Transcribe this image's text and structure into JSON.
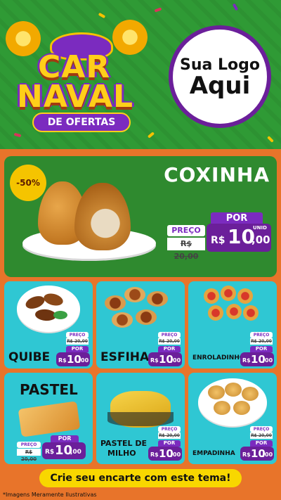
{
  "header": {
    "title_line1": "CAR",
    "title_line2": "NAVAL",
    "subtitle": "DE OFERTAS",
    "logo_line1": "Sua Logo",
    "logo_line2": "Aqui"
  },
  "featured": {
    "name": "COXINHA",
    "discount": "-50%",
    "por_label": "POR",
    "preco_label": "PREÇO",
    "old_price": "R$ 20,00",
    "currency": "R$",
    "price_int": "10",
    "price_dec": ",00",
    "unit": "UNID"
  },
  "products": [
    {
      "name": "QUIBE",
      "preco_label": "PREÇO",
      "old_price": "R$ 20,00",
      "por_label": "POR",
      "currency": "R$",
      "price_int": "10",
      "price_dec": ",00",
      "unit": "UNID"
    },
    {
      "name": "ESFIHA",
      "preco_label": "PREÇO",
      "old_price": "R$ 20,00",
      "por_label": "POR",
      "currency": "R$",
      "price_int": "10",
      "price_dec": ",00",
      "unit": "UNID"
    },
    {
      "name": "ENROLADINHO",
      "preco_label": "PREÇO",
      "old_price": "R$ 20,00",
      "por_label": "POR",
      "currency": "R$",
      "price_int": "10",
      "price_dec": ",00",
      "unit": "UNID"
    },
    {
      "name": "PASTEL",
      "preco_label": "PREÇO",
      "old_price": "R$ 20,00",
      "por_label": "POR",
      "currency": "R$",
      "price_int": "10",
      "price_dec": ",00",
      "unit": "UNID"
    },
    {
      "name_line1": "PASTEL DE",
      "name_line2": "MILHO",
      "preco_label": "PREÇO",
      "old_price": "R$ 20,00",
      "por_label": "POR",
      "currency": "R$",
      "price_int": "10",
      "price_dec": ",00",
      "unit": "UNID"
    },
    {
      "name": "EMPADINHA",
      "preco_label": "PREÇO",
      "old_price": "R$ 20,00",
      "por_label": "POR",
      "currency": "R$",
      "price_int": "10",
      "price_dec": ",00",
      "unit": "UNID"
    }
  ],
  "footer": {
    "cta": "Crie seu encarte com este tema!",
    "disclaimer": "*Imagens Meramente Ilustrativas"
  },
  "colors": {
    "header_green": "#2f9a35",
    "featured_green": "#2f8a2f",
    "card_cyan": "#2fc7d3",
    "price_purple": "#6b1f9a",
    "cta_yellow": "#f8d700",
    "background_orange": "#e8742a"
  }
}
